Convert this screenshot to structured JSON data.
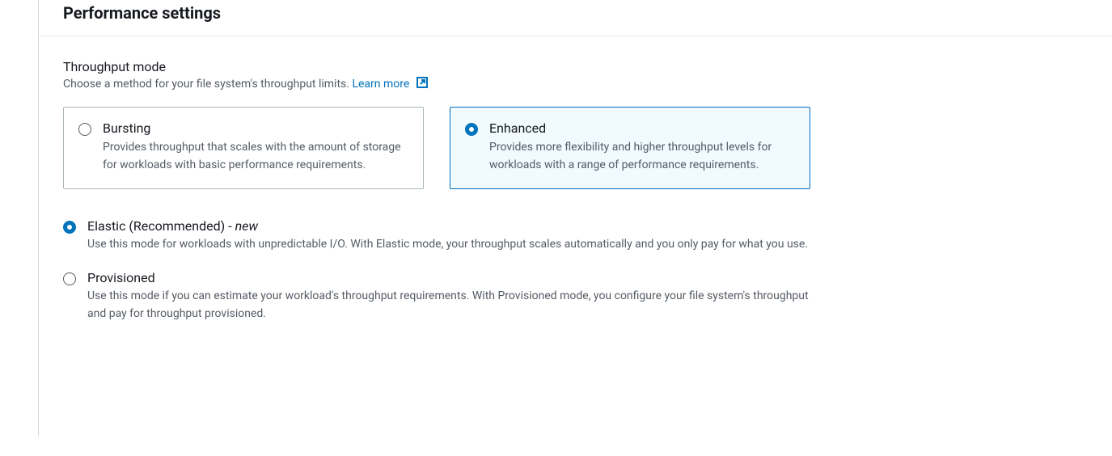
{
  "section": {
    "title": "Performance settings"
  },
  "throughput": {
    "label": "Throughput mode",
    "description": "Choose a method for your file system's throughput limits. ",
    "learn_more": "Learn more",
    "tiles": {
      "bursting": {
        "title": "Bursting",
        "description": "Provides throughput that scales with the amount of storage for workloads with basic performance requirements.",
        "selected": false
      },
      "enhanced": {
        "title": "Enhanced",
        "description": "Provides more flexibility and higher throughput levels for workloads with a range of performance requirements.",
        "selected": true
      }
    },
    "sub_options": {
      "elastic": {
        "title": "Elastic (Recommended)",
        "suffix": " - ",
        "new_badge": "new",
        "description": "Use this mode for workloads with unpredictable I/O. With Elastic mode, your throughput scales automatically and you only pay for what you use.",
        "selected": true
      },
      "provisioned": {
        "title": "Provisioned",
        "description": "Use this mode if you can estimate your workload's throughput requirements. With Provisioned mode, you configure your file system's throughput and pay for throughput provisioned.",
        "selected": false
      }
    }
  }
}
